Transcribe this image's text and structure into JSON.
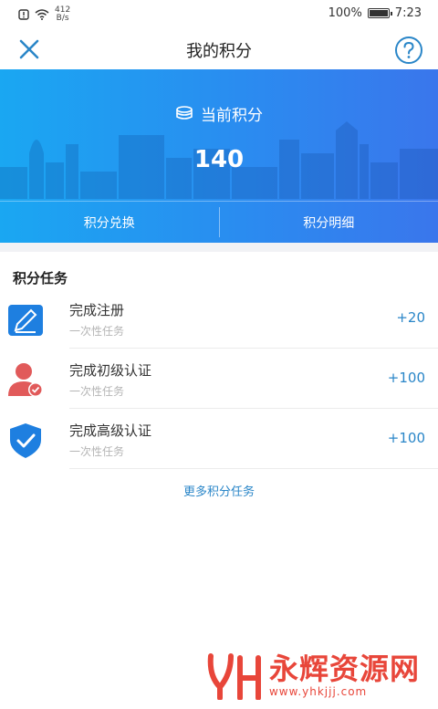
{
  "status_bar": {
    "net_speed_value": "412",
    "net_speed_unit": "B/s",
    "battery": "100%",
    "time": "7:23"
  },
  "nav": {
    "title": "我的积分",
    "close_icon": "close-icon",
    "help_icon": "help-icon"
  },
  "hero": {
    "label": "当前积分",
    "value": "140",
    "exchange_label": "积分兑换",
    "detail_label": "积分明细",
    "gradient": [
      "#1aa7f2",
      "#3a76ec"
    ]
  },
  "tasks": {
    "section_title": "积分任务",
    "items": [
      {
        "name": "完成注册",
        "desc": "一次性任务",
        "points": "+20",
        "icon": "edit-icon"
      },
      {
        "name": "完成初级认证",
        "desc": "一次性任务",
        "points": "+100",
        "icon": "user-verified-icon"
      },
      {
        "name": "完成高级认证",
        "desc": "一次性任务",
        "points": "+100",
        "icon": "shield-check-icon"
      }
    ],
    "more_label": "更多积分任务"
  },
  "watermark": {
    "title": "永辉资源网",
    "url": "www.yhkjjj.com"
  },
  "colors": {
    "accent": "#2a86c8",
    "watermark": "#e8463a"
  }
}
